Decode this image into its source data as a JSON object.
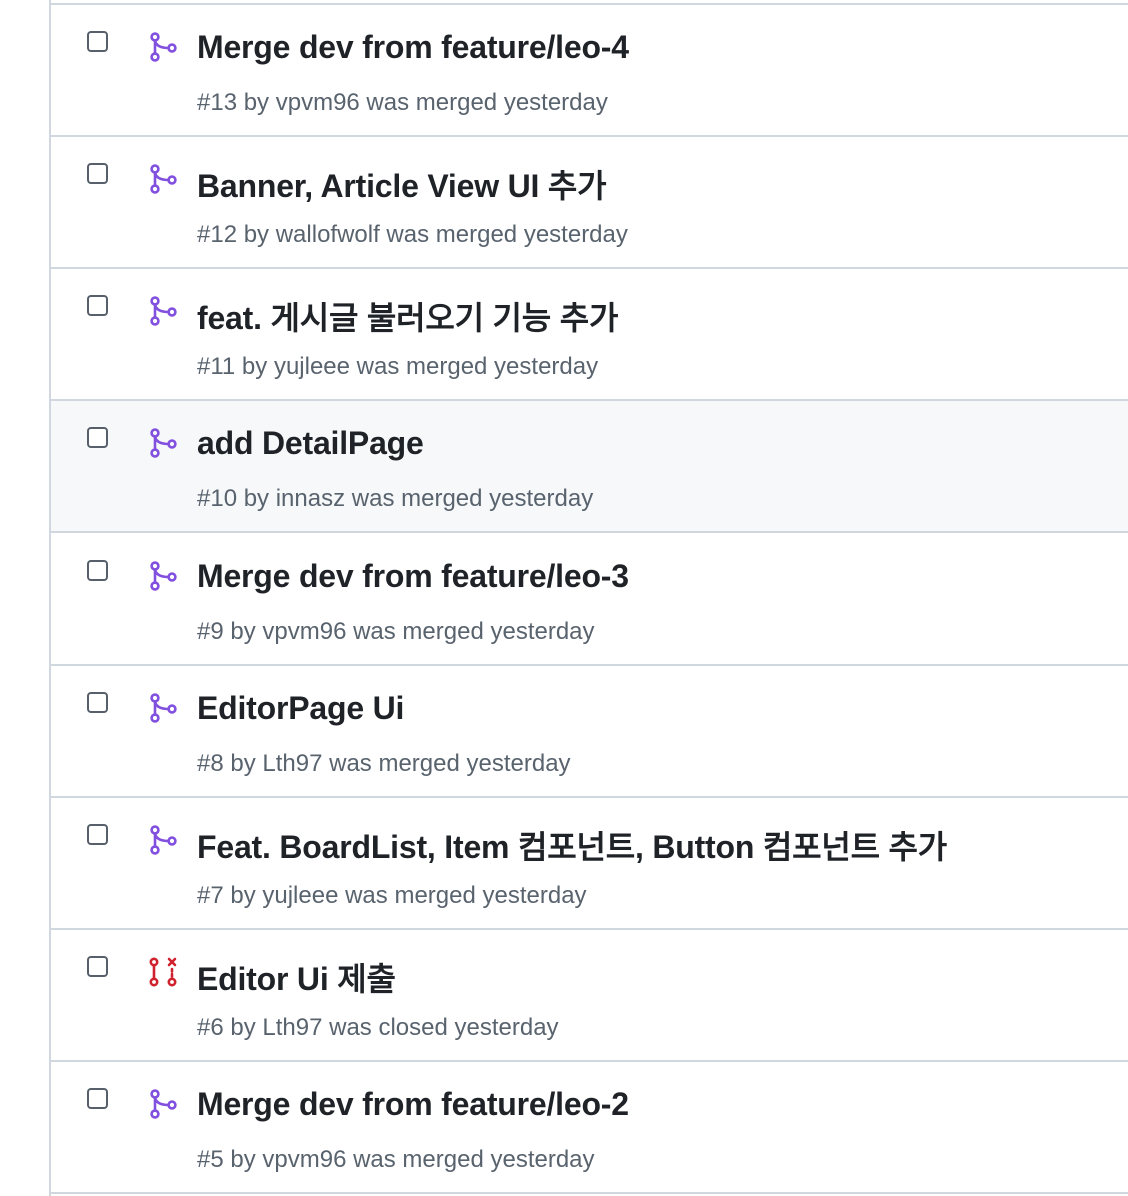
{
  "colors": {
    "merged": "#8250df",
    "closed": "#cf222e",
    "title": "#1f2328",
    "meta": "#59636e",
    "border": "#d0d7de",
    "hover_bg": "#f6f8fa"
  },
  "pull_requests": [
    {
      "title": "Merge dev from feature/leo-4",
      "meta": "#13 by vpvm96 was merged yesterday",
      "state": "merged",
      "icon": "git-merge-icon"
    },
    {
      "title": "Banner, Article View UI 추가",
      "meta": "#12 by wallofwolf was merged yesterday",
      "state": "merged",
      "icon": "git-merge-icon"
    },
    {
      "title": "feat. 게시글 불러오기 기능 추가",
      "meta": "#11 by yujleee was merged yesterday",
      "state": "merged",
      "icon": "git-merge-icon"
    },
    {
      "title": "add DetailPage",
      "meta": "#10 by innasz was merged yesterday",
      "state": "merged",
      "icon": "git-merge-icon",
      "hover": true
    },
    {
      "title": "Merge dev from feature/leo-3",
      "meta": "#9 by vpvm96 was merged yesterday",
      "state": "merged",
      "icon": "git-merge-icon"
    },
    {
      "title": "EditorPage Ui",
      "meta": "#8 by Lth97 was merged yesterday",
      "state": "merged",
      "icon": "git-merge-icon"
    },
    {
      "title": "Feat. BoardList, Item 컴포넌트, Button 컴포넌트 추가",
      "meta": "#7 by yujleee was merged yesterday",
      "state": "merged",
      "icon": "git-merge-icon"
    },
    {
      "title": "Editor Ui 제출",
      "meta": "#6 by Lth97 was closed yesterday",
      "state": "closed",
      "icon": "git-pull-request-closed-icon"
    },
    {
      "title": "Merge dev from feature/leo-2",
      "meta": "#5 by vpvm96 was merged yesterday",
      "state": "merged",
      "icon": "git-merge-icon"
    }
  ]
}
